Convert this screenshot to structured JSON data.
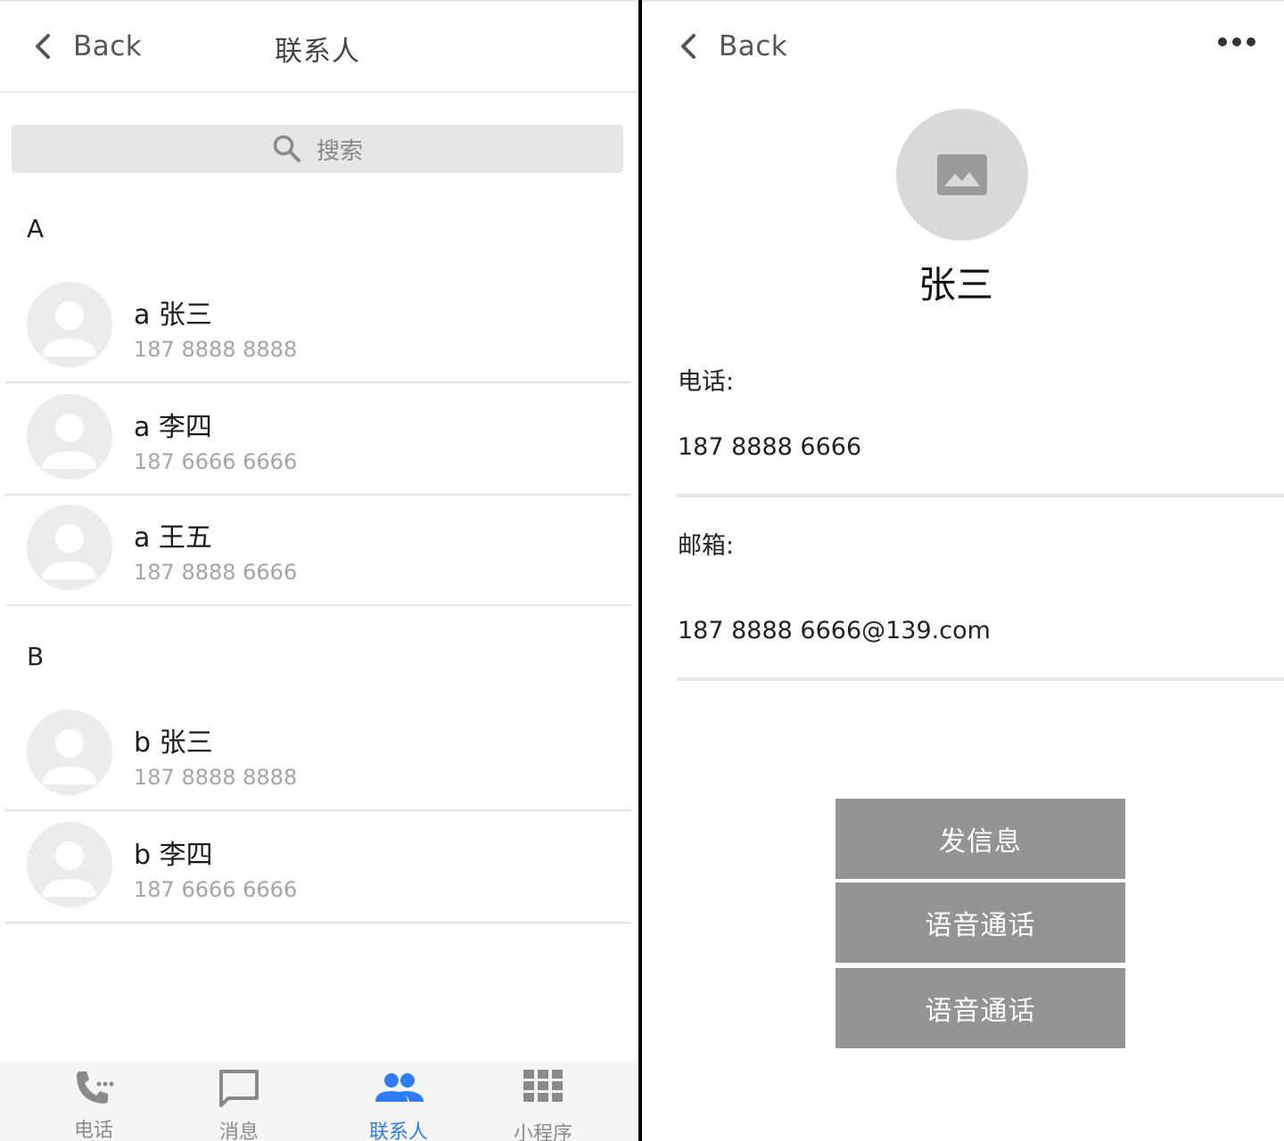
{
  "left": {
    "nav": {
      "back_label": "Back",
      "title": "联系人"
    },
    "search": {
      "placeholder": "搜索"
    },
    "sections": [
      {
        "letter": "A",
        "contacts": [
          {
            "name": "a 张三",
            "phone": "187 8888 8888"
          },
          {
            "name": "a 李四",
            "phone": "187 6666 6666"
          },
          {
            "name": "a 王五",
            "phone": "187 8888 6666"
          }
        ]
      },
      {
        "letter": "B",
        "contacts": [
          {
            "name": "b 张三",
            "phone": "187 8888 8888"
          },
          {
            "name": "b 李四",
            "phone": "187 6666 6666"
          }
        ]
      }
    ],
    "tabbar": {
      "items": [
        {
          "label": "电话",
          "icon": "phone-icon"
        },
        {
          "label": "消息",
          "icon": "message-icon"
        },
        {
          "label": "联系人",
          "icon": "contacts-icon",
          "active": true
        },
        {
          "label": "小程序",
          "icon": "apps-grid-icon"
        }
      ],
      "active_color": "#2f7cf6",
      "inactive_color": "#8a8a8a"
    }
  },
  "right": {
    "nav": {
      "back_label": "Back",
      "more_icon": "more-horizontal-icon"
    },
    "contact": {
      "name": "张三",
      "phone_label": "电话:",
      "phone_value": "187 8888 6666",
      "email_label": "邮箱:",
      "email_value": "187 8888 6666@139.com"
    },
    "actions": [
      {
        "label": "发信息"
      },
      {
        "label": "语音通话"
      },
      {
        "label": "语音通话"
      }
    ],
    "button_color": "#949494"
  }
}
